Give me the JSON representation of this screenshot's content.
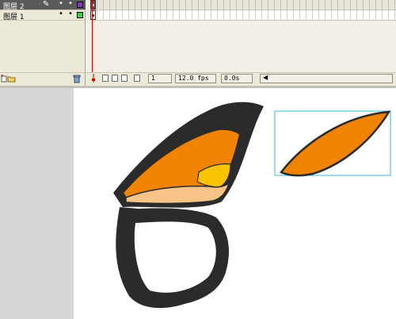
{
  "layers": [
    {
      "name": "图层 2",
      "selected": true,
      "swatch_color": "#8a34c2"
    },
    {
      "name": "图层 1",
      "selected": false,
      "swatch_color": "#3cd23c"
    }
  ],
  "timeline": {
    "current_frame": "1",
    "frame_rate": "12.0 fps",
    "elapsed_time": "0.0s",
    "playhead_color": "#d40000"
  },
  "icons": {
    "insert_layer": "insert-layer-icon",
    "add_folder": "add-folder-icon",
    "delete_layer": "trash-icon",
    "center_frame": "center-frame-icon",
    "onion_skin": "onion-skin-icon",
    "onion_skin_outlines": "onion-skin-outlines-icon",
    "edit_multiple_frames": "edit-multiple-frames-icon",
    "modify_onion_markers": "modify-onion-markers-icon"
  },
  "artwork": {
    "outline_color": "#2b2b2b",
    "main_fill": "#f08300",
    "light_fill": "#f9c488",
    "yellow_fill": "#f9c300",
    "selection_color": "#3ab4e6"
  }
}
